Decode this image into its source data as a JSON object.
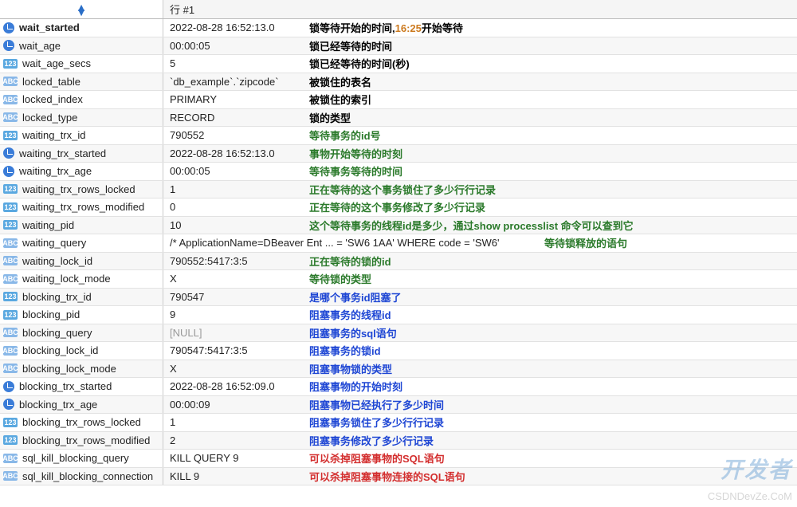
{
  "header": {
    "row_hash": "行 #1"
  },
  "rows": [
    {
      "icon": "clock",
      "name": "wait_started",
      "selected": true,
      "value": "2022-08-28 16:52:13.0",
      "desc": "锁等待开始的时间,16:25开始等待",
      "color": "black"
    },
    {
      "icon": "clock",
      "name": "wait_age",
      "value": "00:00:05",
      "desc": "锁已经等待的时间",
      "color": "black"
    },
    {
      "icon": "123",
      "name": "wait_age_secs",
      "value": "5",
      "desc": "锁已经等待的时间(秒)",
      "color": "black"
    },
    {
      "icon": "abc",
      "name": "locked_table",
      "value": "`db_example`.`zipcode`",
      "desc": "被锁住的表名",
      "color": "black"
    },
    {
      "icon": "abc",
      "name": "locked_index",
      "value": "PRIMARY",
      "desc": "被锁住的索引",
      "color": "black"
    },
    {
      "icon": "abc",
      "name": "locked_type",
      "value": "RECORD",
      "desc": "锁的类型",
      "color": "black"
    },
    {
      "icon": "123",
      "name": "waiting_trx_id",
      "value": "790552",
      "desc": "等待事务的id号",
      "color": "green"
    },
    {
      "icon": "clock",
      "name": "waiting_trx_started",
      "value": "2022-08-28 16:52:13.0",
      "desc": "事物开始等待的时刻",
      "color": "green"
    },
    {
      "icon": "clock",
      "name": "waiting_trx_age",
      "value": "00:00:05",
      "desc": "等待事务等待的时间",
      "color": "green"
    },
    {
      "icon": "123",
      "name": "waiting_trx_rows_locked",
      "value": "1",
      "desc": "正在等待的这个事务锁住了多少行行记录",
      "color": "green"
    },
    {
      "icon": "123",
      "name": "waiting_trx_rows_modified",
      "value": "0",
      "desc": "正在等待的这个事务修改了多少行记录",
      "color": "green"
    },
    {
      "icon": "123",
      "name": "waiting_pid",
      "value": "10",
      "desc": "这个等待事务的线程id是多少，通过show processlist 命令可以查到它",
      "color": "green"
    },
    {
      "icon": "abc",
      "name": "waiting_query",
      "value": "/* ApplicationName=DBeaver Ent ... = 'SW6 1AA' WHERE code = 'SW6'",
      "wideValue": true,
      "desc": "等待锁释放的语句",
      "color": "green"
    },
    {
      "icon": "abc",
      "name": "waiting_lock_id",
      "value": "790552:5417:3:5",
      "desc": "正在等待的锁的id",
      "color": "green"
    },
    {
      "icon": "abc",
      "name": "waiting_lock_mode",
      "value": "X",
      "desc": "等待锁的类型",
      "color": "green"
    },
    {
      "icon": "123",
      "name": "blocking_trx_id",
      "value": "790547",
      "desc": "是哪个事务id阻塞了",
      "color": "blue"
    },
    {
      "icon": "123",
      "name": "blocking_pid",
      "value": "9",
      "desc": "阻塞事务的线程id",
      "color": "blue"
    },
    {
      "icon": "abc",
      "name": "blocking_query",
      "value": "[NULL]",
      "isNull": true,
      "desc": "阻塞事务的sql语句",
      "color": "blue"
    },
    {
      "icon": "abc",
      "name": "blocking_lock_id",
      "value": "790547:5417:3:5",
      "desc": "阻塞事务的锁id",
      "color": "blue"
    },
    {
      "icon": "abc",
      "name": "blocking_lock_mode",
      "value": "X",
      "desc": "阻塞事物锁的类型",
      "color": "blue"
    },
    {
      "icon": "clock",
      "name": "blocking_trx_started",
      "value": "2022-08-28 16:52:09.0",
      "desc": "阻塞事物的开始时刻",
      "color": "blue"
    },
    {
      "icon": "clock",
      "name": "blocking_trx_age",
      "value": "00:00:09",
      "desc": "阻塞事物已经执行了多少时间",
      "color": "blue"
    },
    {
      "icon": "123",
      "name": "blocking_trx_rows_locked",
      "value": "1",
      "desc": "阻塞事务锁住了多少行行记录",
      "color": "blue"
    },
    {
      "icon": "123",
      "name": "blocking_trx_rows_modified",
      "value": "2",
      "desc": "阻塞事务修改了多少行记录",
      "color": "blue"
    },
    {
      "icon": "abc",
      "name": "sql_kill_blocking_query",
      "value": "KILL QUERY 9",
      "desc": "可以杀掉阻塞事物的SQL语句",
      "color": "red"
    },
    {
      "icon": "abc",
      "name": "sql_kill_blocking_connection",
      "value": "KILL 9",
      "desc": "可以杀掉阻塞事物连接的SQL语句",
      "color": "red"
    }
  ],
  "watermark": "开发者",
  "watermark2": "CSDNDevZe.CoM"
}
